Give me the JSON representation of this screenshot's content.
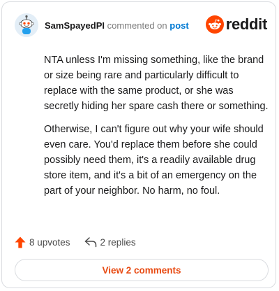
{
  "header": {
    "username": "SamSpayedPI",
    "verb": "commented on",
    "target": "post",
    "logo_text": "reddit",
    "avatar_icon": "snoo-avatar-icon",
    "logo_icon": "reddit-alien-icon"
  },
  "comment": {
    "paragraphs": [
      "NTA unless I'm missing something, like the brand or size being rare and particularly difficult to replace with the same product, or she was secretly hiding her spare cash there or something.",
      "Otherwise, I can't figure out why your wife should even care. You'd replace them before she could possibly need them, it's a readily available drug store item, and it's a bit of an emergency on the part of your neighbor. No harm, no foul."
    ]
  },
  "actions": {
    "upvotes": "8 upvotes",
    "replies": "2 replies",
    "upvote_icon": "upvote-arrow-icon",
    "reply_icon": "reply-arrow-icon"
  },
  "footer": {
    "view_comments": "View 2 comments"
  },
  "colors": {
    "brand": "#ff4500",
    "link": "#0079d3",
    "view_button_text": "#e84a12"
  }
}
